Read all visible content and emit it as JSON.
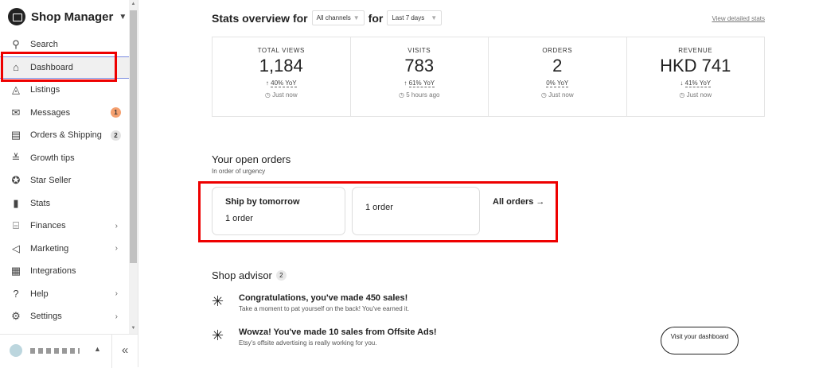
{
  "sidebar": {
    "title": "Shop Manager",
    "items": [
      {
        "label": "Search",
        "icon": "search-icon",
        "glyph": "⚲"
      },
      {
        "label": "Dashboard",
        "icon": "home-icon",
        "glyph": "⌂"
      },
      {
        "label": "Listings",
        "icon": "shapes-icon",
        "glyph": "◬"
      },
      {
        "label": "Messages",
        "icon": "envelope-icon",
        "glyph": "✉",
        "badge": "1"
      },
      {
        "label": "Orders & Shipping",
        "icon": "clipboard-icon",
        "glyph": "▤",
        "badge": "2"
      },
      {
        "label": "Growth tips",
        "icon": "growth-icon",
        "glyph": "≚"
      },
      {
        "label": "Star Seller",
        "icon": "star-badge-icon",
        "glyph": "✪"
      },
      {
        "label": "Stats",
        "icon": "bar-chart-icon",
        "glyph": "▮"
      },
      {
        "label": "Finances",
        "icon": "bank-icon",
        "glyph": "⌸"
      },
      {
        "label": "Marketing",
        "icon": "megaphone-icon",
        "glyph": "◁"
      },
      {
        "label": "Integrations",
        "icon": "grid-icon",
        "glyph": "▦"
      },
      {
        "label": "Help",
        "icon": "help-icon",
        "glyph": "?"
      },
      {
        "label": "Settings",
        "icon": "gear-icon",
        "glyph": "⚙"
      }
    ],
    "collapse": "«"
  },
  "stats": {
    "title": "Stats overview for",
    "channel": "All channels",
    "for": "for",
    "range": "Last 7 days",
    "link": "View detailed stats",
    "cards": [
      {
        "label": "TOTAL VIEWS",
        "value": "1,184",
        "arrow": "↑",
        "yoy": "40% YoY",
        "time": "Just now"
      },
      {
        "label": "VISITS",
        "value": "783",
        "arrow": "↑",
        "yoy": "61% YoY",
        "time": "5 hours ago"
      },
      {
        "label": "ORDERS",
        "value": "2",
        "arrow": "",
        "yoy": "0% YoY",
        "time": "Just now"
      },
      {
        "label": "REVENUE",
        "value": "HKD 741",
        "arrow": "↓",
        "yoy": "41% YoY",
        "time": "Just now"
      }
    ]
  },
  "orders": {
    "title": "Your open orders",
    "subtitle": "In order of urgency",
    "card1_title": "Ship by tomorrow",
    "card1_count": "1 order",
    "card2_count": "1 order",
    "all": "All orders →"
  },
  "advisor": {
    "title": "Shop advisor",
    "count": "2",
    "items": [
      {
        "title": "Congratulations, you've made 450 sales!",
        "desc": "Take a moment to pat yourself on the back! You've earned it."
      },
      {
        "title": "Wowza! You've made 10 sales from Offsite Ads!",
        "desc": "Etsy's offsite advertising is really working for you."
      }
    ],
    "button": "Visit your dashboard"
  },
  "colors": {
    "highlight": "#e00000",
    "badge_orange": "#f5a06f"
  }
}
